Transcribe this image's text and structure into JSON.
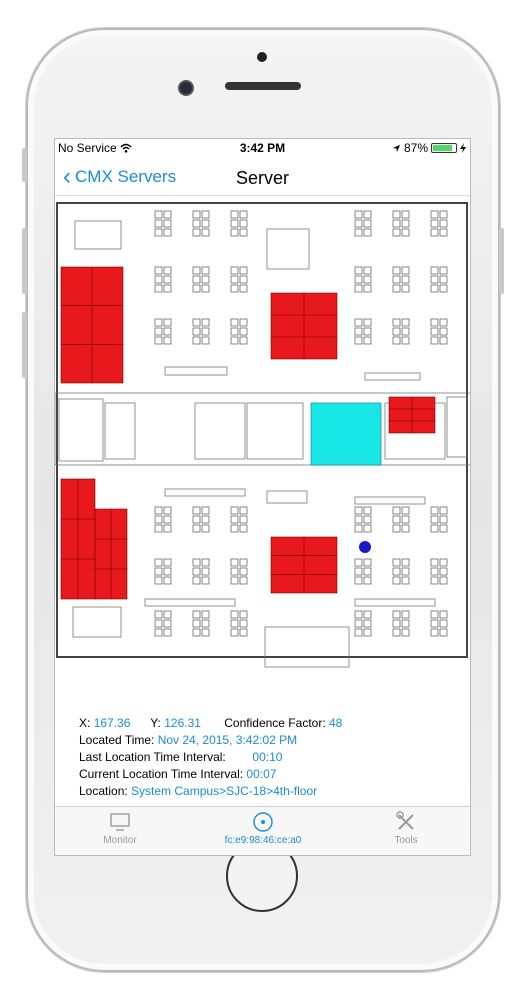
{
  "status": {
    "carrier": "No Service",
    "wifi_icon": "wifi-icon",
    "time": "3:42 PM",
    "battery": "87%",
    "battery_level": 0.87
  },
  "nav": {
    "back_label": "CMX Servers",
    "title": "Server"
  },
  "location": {
    "x_label": "X:",
    "x_value": "167.36",
    "y_label": "Y:",
    "y_value": "126.31",
    "confidence_label": "Confidence Factor:",
    "confidence_value": "48",
    "located_time_label": "Located Time:",
    "located_time_value": "Nov 24, 2015, 3:42:02 PM",
    "last_interval_label": "Last Location Time Interval:",
    "last_interval_value": "00:10",
    "current_interval_label": "Current Location Time Interval:",
    "current_interval_value": "00:07",
    "location_label": "Location:",
    "location_value": "System Campus>SJC-18>4th-floor"
  },
  "tabs": [
    {
      "label": "Monitor",
      "icon": "monitor-icon"
    },
    {
      "label": "fc:e9:98:46:ce:a0",
      "icon": "target-icon"
    },
    {
      "label": "Tools",
      "icon": "tools-icon"
    }
  ],
  "colors": {
    "accent": "#1a8cd8",
    "occupied_room": "#e8191c",
    "selected_room": "#19e6e6",
    "device_marker": "#1a1acc"
  }
}
